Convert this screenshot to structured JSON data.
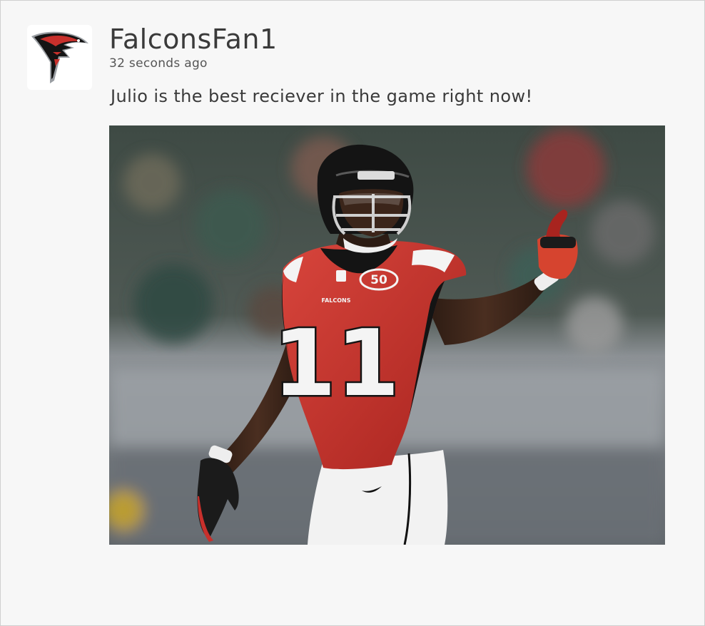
{
  "post": {
    "username": "FalconsFan1",
    "timestamp": "32 seconds ago",
    "text": "Julio is the best reciever in the game right now!"
  },
  "avatar": {
    "icon": "falcons-logo-icon"
  },
  "photo": {
    "subject": "football-player-photo",
    "jersey_number": "11",
    "jersey_team": "FALCONS",
    "patch_text": "50"
  },
  "colors": {
    "card_background": "#f7f7f7",
    "text": "#3a3a3a",
    "jersey_red": "#c8302c",
    "helmet_black": "#141414"
  }
}
